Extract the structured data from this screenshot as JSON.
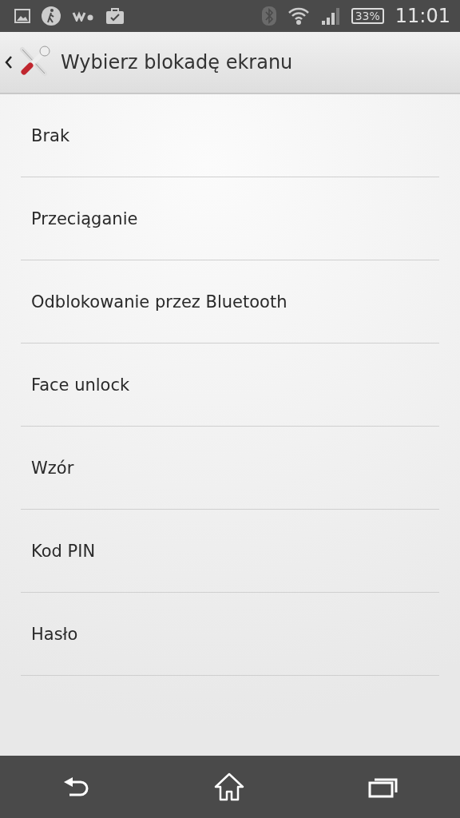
{
  "status_bar": {
    "battery": "33%",
    "time": "11:01"
  },
  "action_bar": {
    "title": "Wybierz blokadę ekranu"
  },
  "options": [
    {
      "label": "Brak"
    },
    {
      "label": "Przeciąganie"
    },
    {
      "label": "Odblokowanie przez Bluetooth"
    },
    {
      "label": "Face unlock"
    },
    {
      "label": "Wzór"
    },
    {
      "label": "Kod PIN"
    },
    {
      "label": "Hasło"
    }
  ]
}
